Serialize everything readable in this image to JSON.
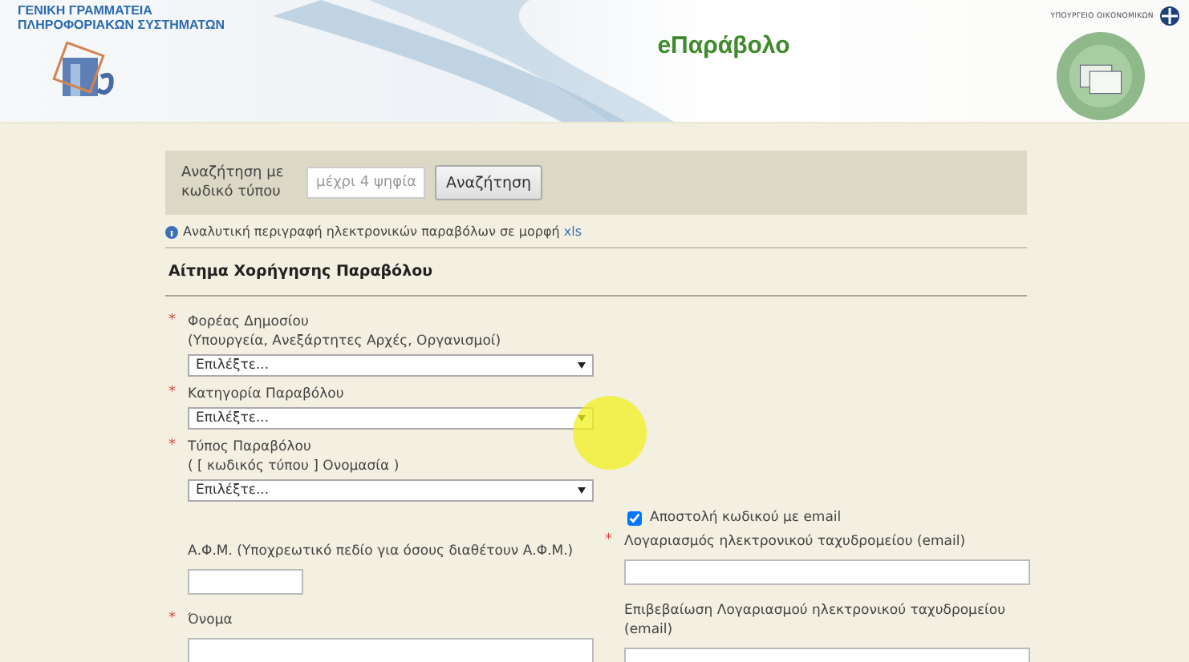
{
  "header": {
    "org_lines": [
      "ΓΕΝΙΚΗ ΓΡΑΜΜΑΤΕΙΑ",
      "ΠΛΗΡΟΦΟΡΙΑΚΩΝ ΣΥΣΤΗΜΑΤΩΝ"
    ],
    "app_title": "eΠαράβολο",
    "ministry": "ΥΠΟΥΡΓΕΙΟ ΟΙΚΟΝΟΜΙΚΩΝ"
  },
  "search": {
    "label": "Αναζήτηση με κωδικό τύπου",
    "placeholder": "μέχρι 4 ψηφία",
    "button": "Αναζήτηση"
  },
  "info": {
    "text": "Αναλυτική περιγραφή ηλεκτρονικών παραβόλων σε μορφή",
    "link": "xls"
  },
  "section_title": "Αίτημα Χορήγησης Παραβόλου",
  "selects": [
    {
      "label": "Φορέας Δημοσίου",
      "sublabel": "(Υπουργεία, Ανεξάρτητες Αρχές, Οργανισμοί)",
      "required_mark": "*",
      "value": "Επιλέξτε..."
    },
    {
      "label": "Κατηγορία Παραβόλου",
      "required_mark": "*",
      "value": "Επιλέξτε..."
    },
    {
      "label": "Τύπος Παραβόλου",
      "sublabel": "( [ κωδικός τύπου ] Ονομασία )",
      "required_mark": "*",
      "value": "Επιλέξτε..."
    }
  ],
  "email_checkbox": {
    "label": "Αποστολή κωδικού με email",
    "checked": true
  },
  "left_fields": [
    {
      "label": "Α.Φ.Μ. (Υποχρεωτικό πεδίο για όσους διαθέτουν Α.Φ.Μ.)",
      "kind": "short"
    },
    {
      "label": "Όνομα",
      "required_mark": "*",
      "kind": "long"
    }
  ],
  "right_fields": [
    {
      "label": "Λογαριασμός ηλεκτρονικού ταχυδρομείου (email)",
      "required_mark": "*",
      "kind": "long"
    },
    {
      "label": "Επιβεβαίωση Λογαριασμού ηλεκτρονικού ταχυδρομείου (email)",
      "kind": "long"
    }
  ]
}
